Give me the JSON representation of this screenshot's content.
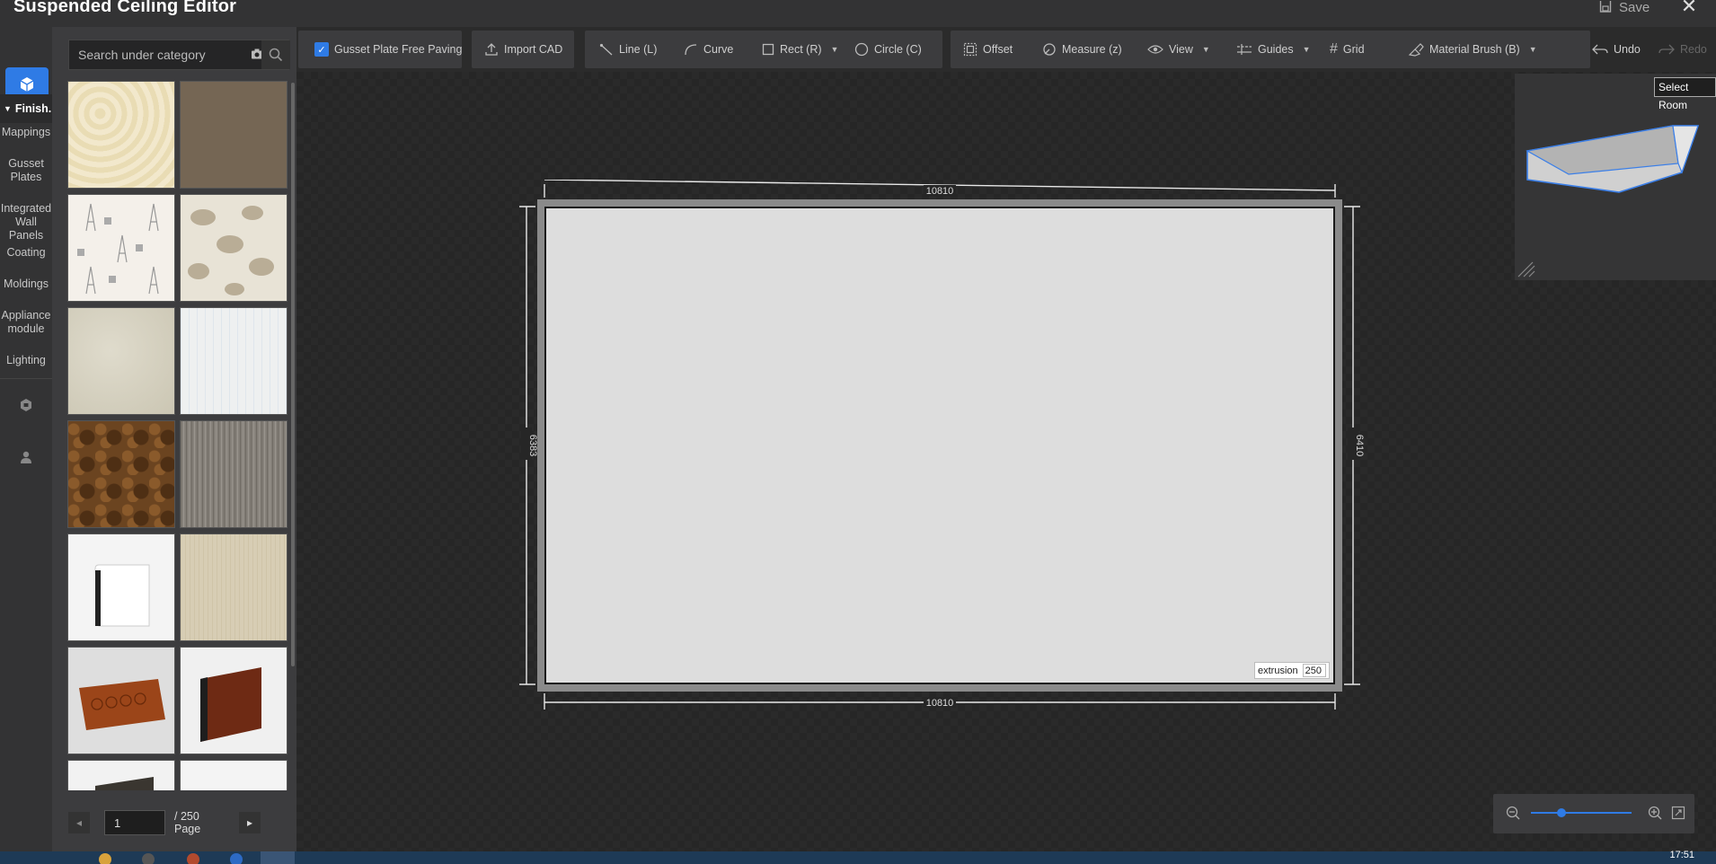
{
  "titlebar": {
    "title": "Suspended Ceiling Editor",
    "save_label": "Save"
  },
  "leftnav": {
    "group_label": "Finish...",
    "items": [
      "Mappings",
      "Gusset Plates",
      "Integrated Wall Panels",
      "Coating",
      "Moldings",
      "Appliance module",
      "Lighting"
    ]
  },
  "catalog": {
    "search_placeholder": "Search under category",
    "page_value": "1",
    "page_total": "/ 250 Page",
    "thumbs": [
      "damask-cream",
      "taupe-plain",
      "eiffel-tower-pattern",
      "animal-pattern",
      "cream-marble",
      "blue-pinstripe",
      "brown-granite",
      "grey-stripe",
      "white-baseboard",
      "beige-wood",
      "carved-wood-panel",
      "mahogany-baseboard",
      "dark-trim",
      "light-trim"
    ]
  },
  "toolbar": {
    "gusset_paving": "Gusset Plate Free Paving",
    "gusset_checked": true,
    "import_cad": "Import CAD",
    "line": "Line (L)",
    "curve": "Curve",
    "rect": "Rect (R)",
    "circle": "Circle (C)",
    "offset": "Offset",
    "measure": "Measure (z)",
    "view": "View",
    "guides": "Guides",
    "grid": "Grid",
    "material_brush": "Material Brush (B)",
    "undo": "Undo",
    "redo": "Redo"
  },
  "room": {
    "select_room": "Select Room"
  },
  "drawing": {
    "dim_top": "10810",
    "dim_bottom": "10810",
    "dim_left": "6383",
    "dim_right": "6410",
    "extrusion_label": "extrusion",
    "extrusion_value": "250"
  },
  "zoom": {
    "level": 0.3
  },
  "taskbar": {
    "clock": "17:51"
  },
  "colors": {
    "accent": "#2f7be5",
    "panel": "#3c3c3e",
    "canvas": "#262626",
    "room_fill": "#dddddd"
  }
}
